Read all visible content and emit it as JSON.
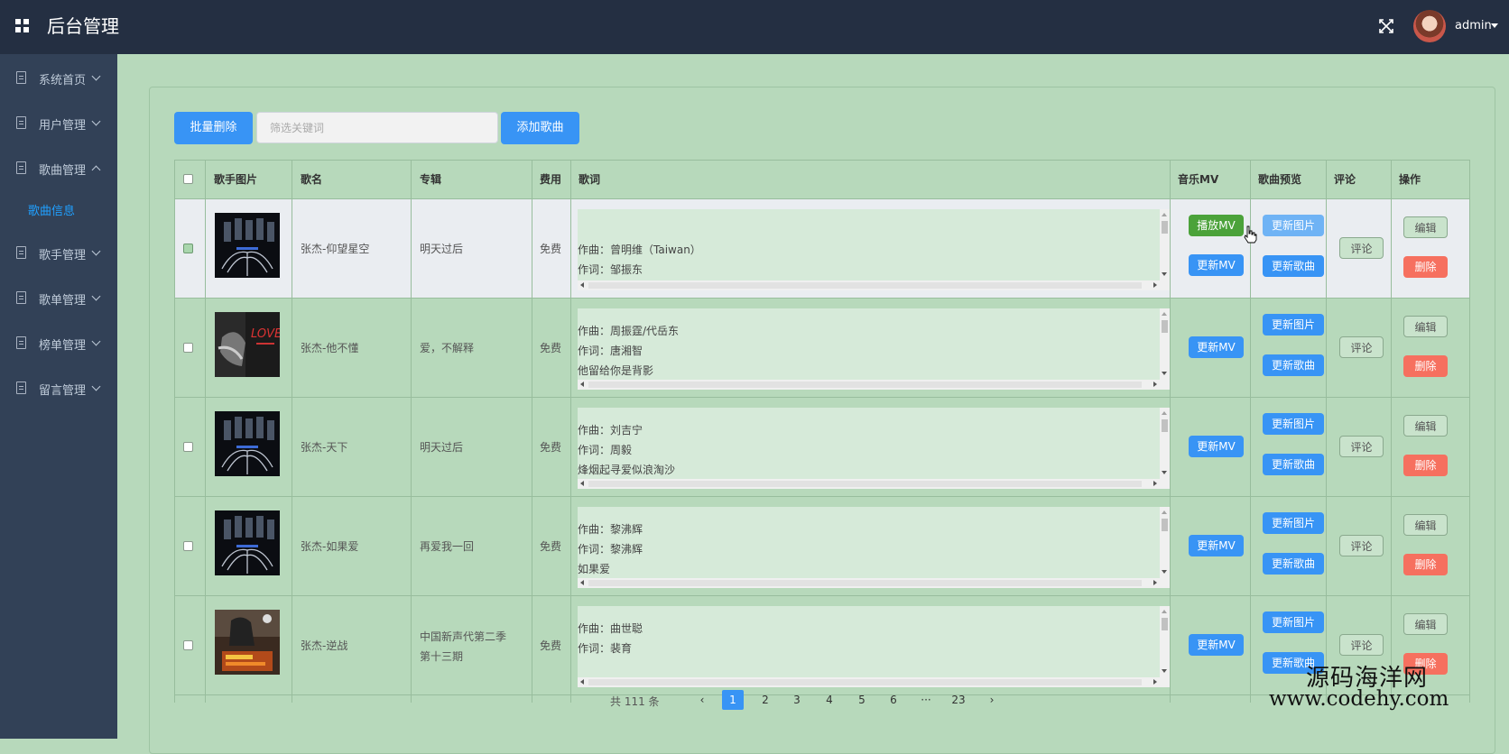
{
  "header": {
    "title": "后台管理",
    "user": "admin",
    "menu_icon": "grid-icon",
    "fullscreen_icon": "fullscreen-icon"
  },
  "sidebar": {
    "items": [
      {
        "label": "系统首页",
        "icon": "document-icon",
        "expanded": false
      },
      {
        "label": "用户管理",
        "icon": "document-icon",
        "expanded": false
      },
      {
        "label": "歌曲管理",
        "icon": "document-icon",
        "expanded": true
      },
      {
        "label": "歌手管理",
        "icon": "document-icon",
        "expanded": false
      },
      {
        "label": "歌单管理",
        "icon": "document-icon",
        "expanded": false
      },
      {
        "label": "榜单管理",
        "icon": "document-icon",
        "expanded": false
      },
      {
        "label": "留言管理",
        "icon": "document-icon",
        "expanded": false
      }
    ],
    "active_sub": "歌曲信息"
  },
  "toolbar": {
    "batch_delete": "批量删除",
    "search_placeholder": "筛选关键词",
    "add_song": "添加歌曲"
  },
  "table": {
    "headers": [
      "歌手图片",
      "歌名",
      "专辑",
      "费用",
      "歌词",
      "音乐MV",
      "歌曲预览",
      "评论",
      "操作"
    ],
    "buttons": {
      "play_mv": "播放MV",
      "update_mv": "更新MV",
      "update_pic": "更新图片",
      "update_song": "更新歌曲",
      "comment": "评论",
      "edit": "编辑",
      "delete": "删除"
    },
    "rows": [
      {
        "name": "张杰-仰望星空",
        "album": "明天过后",
        "fee": "免费",
        "lyrics": [
          "作曲：曾明维（Taiwan）",
          "作词：邹振东"
        ],
        "has_mv": true,
        "checked": true
      },
      {
        "name": "张杰-他不懂",
        "album": "爱，不解释",
        "fee": "免费",
        "lyrics": [
          "作曲：周振霆/代岳东",
          "作词：唐湘智",
          "他留给你是背影"
        ],
        "has_mv": false,
        "checked": false
      },
      {
        "name": "张杰-天下",
        "album": "明天过后",
        "fee": "免费",
        "lyrics": [
          "作曲：刘吉宁",
          "作词：周毅",
          "烽烟起寻爱似浪淘沙"
        ],
        "has_mv": false,
        "checked": false
      },
      {
        "name": "张杰-如果爱",
        "album": "再爱我一回",
        "fee": "免费",
        "lyrics": [
          "作曲：黎沸辉",
          "作词：黎沸辉",
          "如果爱"
        ],
        "has_mv": false,
        "checked": false
      },
      {
        "name": "张杰-逆战",
        "album": [
          "中国新声代第二季",
          "第十三期"
        ],
        "fee": "免费",
        "lyrics": [
          "作曲：曲世聪",
          "作词：裴育"
        ],
        "has_mv": false,
        "checked": false
      }
    ]
  },
  "pagination": {
    "total": "共 111 条",
    "pages": [
      "1",
      "2",
      "3",
      "4",
      "5",
      "6",
      "···",
      "23"
    ],
    "current": "1"
  },
  "watermark": {
    "line1": "源码海洋网",
    "line2": "www.codehy.com"
  },
  "colors": {
    "header_bg": "#242f42",
    "sidebar_bg": "#324157",
    "page_bg": "#b7d9bb",
    "primary": "#3894f5",
    "danger": "#f6705f",
    "success": "#4ba23a"
  }
}
